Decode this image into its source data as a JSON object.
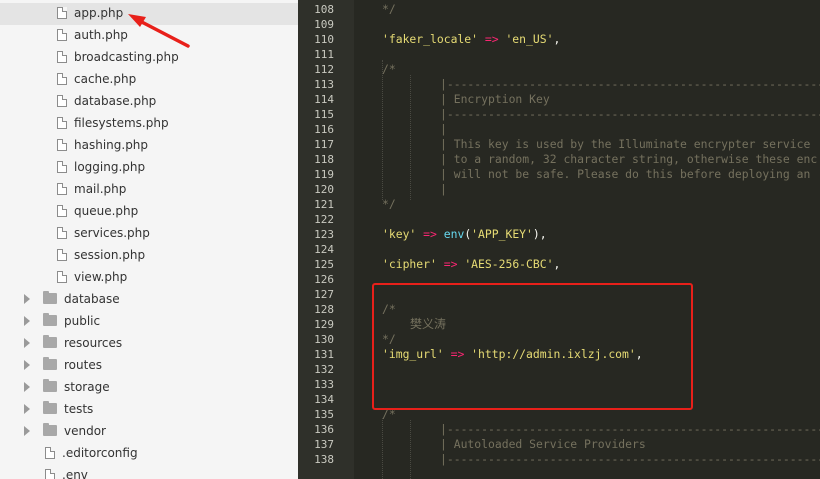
{
  "sidebar": {
    "files": [
      {
        "label": "app.php",
        "selected": true
      },
      {
        "label": "auth.php"
      },
      {
        "label": "broadcasting.php"
      },
      {
        "label": "cache.php"
      },
      {
        "label": "database.php"
      },
      {
        "label": "filesystems.php"
      },
      {
        "label": "hashing.php"
      },
      {
        "label": "logging.php"
      },
      {
        "label": "mail.php"
      },
      {
        "label": "queue.php"
      },
      {
        "label": "services.php"
      },
      {
        "label": "session.php"
      },
      {
        "label": "view.php"
      }
    ],
    "folders": [
      {
        "label": "database"
      },
      {
        "label": "public"
      },
      {
        "label": "resources"
      },
      {
        "label": "routes"
      },
      {
        "label": "storage"
      },
      {
        "label": "tests"
      },
      {
        "label": "vendor"
      }
    ],
    "root_files": [
      {
        "label": ".editorconfig"
      },
      {
        "label": ".env"
      }
    ]
  },
  "annotations": {
    "arrow_color": "#e8201a",
    "highlight_color": "#e8201a"
  },
  "editor": {
    "theme": {
      "background": "#272822",
      "string": "#e6db74",
      "operator": "#f92672",
      "function": "#66d9ef",
      "comment": "#75715e"
    },
    "lines": [
      {
        "n": "108",
        "tokens": [
          {
            "t": "*/",
            "c": "cmt"
          }
        ],
        "indent": 0
      },
      {
        "n": "109",
        "tokens": [],
        "indent": 0
      },
      {
        "n": "110",
        "tokens": [
          {
            "t": "'faker_locale'",
            "c": "str"
          },
          {
            "t": " => ",
            "c": "op"
          },
          {
            "t": "'en_US'",
            "c": "str"
          },
          {
            "t": ",",
            "c": ""
          }
        ],
        "indent": 0
      },
      {
        "n": "111",
        "tokens": [],
        "indent": 0
      },
      {
        "n": "112",
        "tokens": [
          {
            "t": "/*",
            "c": "cmt"
          }
        ],
        "indent": 0
      },
      {
        "n": "113",
        "tokens": [
          {
            "t": "|-----------------------------------------------------------------------",
            "c": "cmt"
          }
        ],
        "indent": 1
      },
      {
        "n": "114",
        "tokens": [
          {
            "t": "| Encryption Key",
            "c": "cmt"
          }
        ],
        "indent": 1
      },
      {
        "n": "115",
        "tokens": [
          {
            "t": "|-----------------------------------------------------------------------",
            "c": "cmt"
          }
        ],
        "indent": 1
      },
      {
        "n": "116",
        "tokens": [
          {
            "t": "|",
            "c": "cmt"
          }
        ],
        "indent": 1
      },
      {
        "n": "117",
        "tokens": [
          {
            "t": "| This key is used by the Illuminate encrypter service",
            "c": "cmt"
          }
        ],
        "indent": 1
      },
      {
        "n": "118",
        "tokens": [
          {
            "t": "| to a random, 32 character string, otherwise these enc",
            "c": "cmt"
          }
        ],
        "indent": 1
      },
      {
        "n": "119",
        "tokens": [
          {
            "t": "| will not be safe. Please do this before deploying an",
            "c": "cmt"
          }
        ],
        "indent": 1
      },
      {
        "n": "120",
        "tokens": [
          {
            "t": "|",
            "c": "cmt"
          }
        ],
        "indent": 1
      },
      {
        "n": "121",
        "tokens": [
          {
            "t": "*/",
            "c": "cmt"
          }
        ],
        "indent": 0
      },
      {
        "n": "122",
        "tokens": [],
        "indent": 0
      },
      {
        "n": "123",
        "tokens": [
          {
            "t": "'key'",
            "c": "str"
          },
          {
            "t": " => ",
            "c": "op"
          },
          {
            "t": "env",
            "c": "fn"
          },
          {
            "t": "(",
            "c": ""
          },
          {
            "t": "'APP_KEY'",
            "c": "str"
          },
          {
            "t": "),",
            "c": ""
          }
        ],
        "indent": 0
      },
      {
        "n": "124",
        "tokens": [],
        "indent": 0
      },
      {
        "n": "125",
        "tokens": [
          {
            "t": "'cipher'",
            "c": "str"
          },
          {
            "t": " => ",
            "c": "op"
          },
          {
            "t": "'AES-256-CBC'",
            "c": "str"
          },
          {
            "t": ",",
            "c": ""
          }
        ],
        "indent": 0
      },
      {
        "n": "126",
        "tokens": [],
        "indent": 0
      },
      {
        "n": "127",
        "tokens": [],
        "indent": 0
      },
      {
        "n": "128",
        "tokens": [
          {
            "t": "/*",
            "c": "cmt"
          }
        ],
        "indent": 0
      },
      {
        "n": "129",
        "tokens": [
          {
            "t": "樊义涛",
            "c": "cmt-cn"
          }
        ],
        "indent": 2
      },
      {
        "n": "130",
        "tokens": [
          {
            "t": "*/",
            "c": "cmt"
          }
        ],
        "indent": 0
      },
      {
        "n": "131",
        "tokens": [
          {
            "t": "'img_url'",
            "c": "str"
          },
          {
            "t": " => ",
            "c": "op"
          },
          {
            "t": "'http://admin.ixlzj.com'",
            "c": "str"
          },
          {
            "t": ",",
            "c": ""
          }
        ],
        "indent": 0
      },
      {
        "n": "132",
        "tokens": [],
        "indent": 0
      },
      {
        "n": "133",
        "tokens": [],
        "indent": 0
      },
      {
        "n": "134",
        "tokens": [],
        "indent": 0
      },
      {
        "n": "135",
        "tokens": [
          {
            "t": "/*",
            "c": "cmt"
          }
        ],
        "indent": 0
      },
      {
        "n": "136",
        "tokens": [
          {
            "t": "|-----------------------------------------------------------------------",
            "c": "cmt"
          }
        ],
        "indent": 1
      },
      {
        "n": "137",
        "tokens": [
          {
            "t": "| Autoloaded Service Providers",
            "c": "cmt"
          }
        ],
        "indent": 1
      },
      {
        "n": "138",
        "tokens": [
          {
            "t": "|-----------------------------------------------------------------------",
            "c": "cmt"
          }
        ],
        "indent": 1
      }
    ]
  }
}
